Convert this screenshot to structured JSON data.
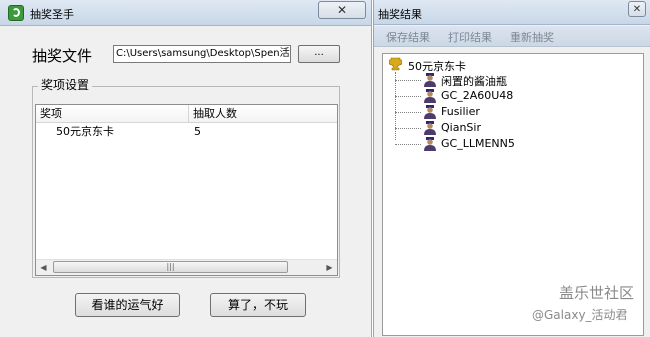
{
  "left_window": {
    "title": "抽奖圣手",
    "close_glyph": "✕",
    "file_label": "抽奖文件",
    "file_path": "C:\\Users\\samsung\\Desktop\\Spen活",
    "browse_label": "...",
    "group_title": "奖项设置",
    "columns": [
      "奖项",
      "抽取人数"
    ],
    "rows": [
      {
        "prize": "50元京东卡",
        "count": "5"
      }
    ],
    "btn_draw": "看谁的运气好",
    "btn_quit": "算了，不玩"
  },
  "right_window": {
    "title": "抽奖结果",
    "close_glyph": "✕",
    "menu": [
      "保存结果",
      "打印结果",
      "重新抽奖"
    ],
    "tree": {
      "root": "50元京东卡",
      "children": [
        "闲置的酱油瓶",
        "GC_2A60U48",
        "Fusilier",
        "QianSir",
        "GC_LLMENN5"
      ]
    }
  },
  "watermark": {
    "line1": "盖乐世社区",
    "line2": "@Galaxy_活动君"
  }
}
